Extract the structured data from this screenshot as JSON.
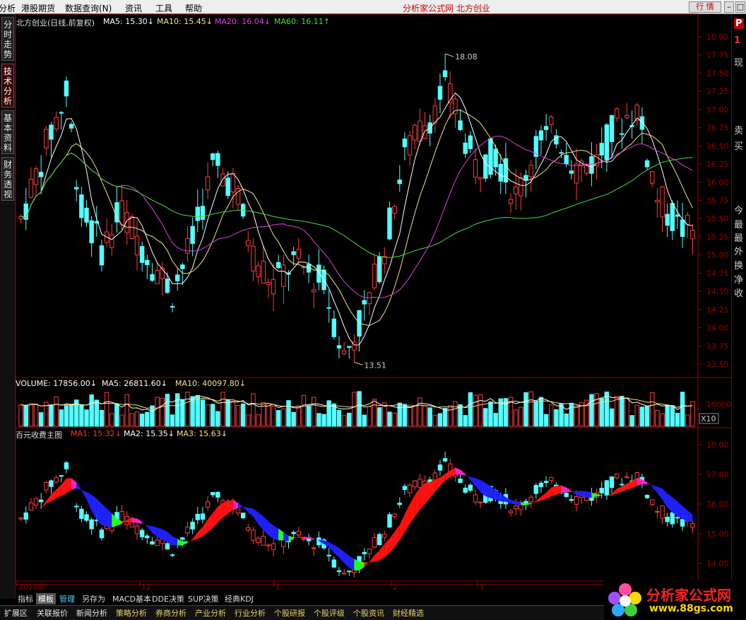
{
  "menu": {
    "items": [
      "分析",
      "港股期货",
      "数据查询(N)",
      "资讯",
      "工具",
      "帮助"
    ]
  },
  "site_title": "分析家公式网  北方创业",
  "window_buttons": {
    "quote": "行 情",
    "min": "–",
    "max": "□",
    "close": "×"
  },
  "left_tabs": [
    "分时走势",
    "技术分析",
    "基本资料",
    "财务透视"
  ],
  "right_panel": {
    "p_label": "P",
    "p_value": "1",
    "chars_top": [
      "现"
    ],
    "chars_mid": [
      "卖",
      "买"
    ],
    "chars_bottom": [
      "今",
      "最",
      "最",
      "外",
      "换",
      "净",
      "收"
    ]
  },
  "price_panel": {
    "stock": "北方创业(日线,前复权)",
    "ma_labels": [
      {
        "label": "MA5: 15.30↓",
        "color": "#ffffff"
      },
      {
        "label": "MA10: 15.45↓",
        "color": "#f5e28c"
      },
      {
        "label": "MA20: 16.04↓",
        "color": "#e040e0"
      },
      {
        "label": "MA60: 16.11↑",
        "color": "#40e040"
      }
    ],
    "high_label": "18.08",
    "low_label": "13.51",
    "yticks": [
      "18.00",
      "17.75",
      "17.50",
      "17.25",
      "17.00",
      "16.75",
      "16.50",
      "16.25",
      "16.00",
      "15.75",
      "15.50",
      "15.25",
      "15.00",
      "14.75",
      "14.50",
      "14.25",
      "14.00",
      "13.75",
      "13.50"
    ]
  },
  "volume_panel": {
    "labels": [
      {
        "label": "VOLUME: 17856.00↓",
        "color": "#ffffff"
      },
      {
        "label": "MA5: 26811.60↓",
        "color": "#ffffff"
      },
      {
        "label": "MA10: 40097.80↓",
        "color": "#f5e28c"
      }
    ],
    "ytick": "10000",
    "unit": "X10"
  },
  "indicator_panel": {
    "title": "百元收费主图",
    "labels": [
      {
        "label": "MA1: 15.32↓",
        "color": "#ff3030"
      },
      {
        "label": "MA2: 15.35↓",
        "color": "#ffffff"
      },
      {
        "label": "MA3: 15.63↓",
        "color": "#f5e28c"
      }
    ],
    "yticks": [
      "18.00",
      "17.00",
      "16.00",
      "15.00",
      "14.00"
    ]
  },
  "x_axis": [
    "2010年",
    "12",
    "1",
    "2",
    "3"
  ],
  "bottom_tabs": [
    "指标",
    "模板",
    "管理",
    "另存为",
    "MACD基本",
    "DDE决策",
    "SUP决策",
    "经典KDJ"
  ],
  "bottom_bar": [
    {
      "label": "扩展区",
      "style": "w"
    },
    {
      "label": "关联报价",
      "style": "w"
    },
    {
      "label": "新闻分析",
      "style": "w"
    },
    {
      "label": "策略分析",
      "style": "y"
    },
    {
      "label": "券商分析",
      "style": "y"
    },
    {
      "label": "产业分析",
      "style": "y"
    },
    {
      "label": "行业分析",
      "style": "y"
    },
    {
      "label": "个股研报",
      "style": "y"
    },
    {
      "label": "个股评级",
      "style": "y"
    },
    {
      "label": "个股资讯",
      "style": "y"
    },
    {
      "label": "财经精选",
      "style": "y"
    }
  ],
  "logo": {
    "text": "分析家公式网",
    "url": "www.88gs.com"
  },
  "colors": {
    "up": "#ff3c3c",
    "down": "#54ffff",
    "axis": "#9a0000",
    "ma5": "#ffffff",
    "ma10": "#f5e28c",
    "ma20": "#e040e0",
    "ma60": "#40e040"
  }
}
